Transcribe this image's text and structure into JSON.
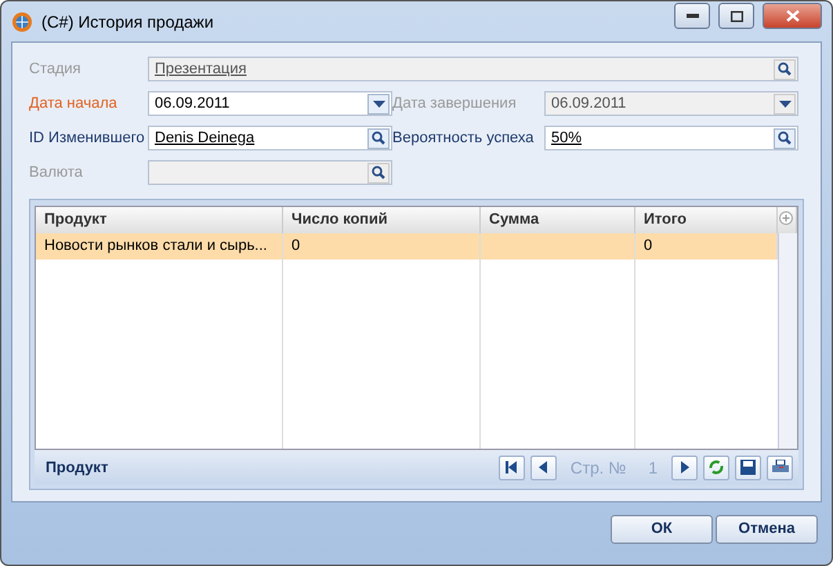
{
  "window": {
    "title": "(C#) История продажи"
  },
  "fields": [
    {
      "label": "Стадия",
      "value": "Презентация",
      "disabled": true,
      "required": false,
      "link": true,
      "kind": "search",
      "wide": true
    },
    {
      "label": "Дата начала",
      "value": "06.09.2011",
      "disabled": false,
      "required": true,
      "link": false,
      "kind": "dropdown",
      "wide": false
    },
    {
      "label": "Дата завершения",
      "value": "06.09.2011",
      "disabled": true,
      "required": false,
      "link": false,
      "kind": "dropdown",
      "wide": false
    },
    {
      "label": "ID Изменившего",
      "value": "Denis Deinega",
      "disabled": false,
      "required": false,
      "link": true,
      "kind": "search",
      "wide": false
    },
    {
      "label": "Вероятность успеха",
      "value": "50%",
      "disabled": false,
      "required": false,
      "link": true,
      "kind": "search",
      "wide": false
    },
    {
      "label": "Валюта",
      "disabled": true,
      "required": false,
      "link": false,
      "kind": "search",
      "wide": false
    }
  ],
  "table": {
    "columns": [
      "Продукт",
      "Число копий",
      "Сумма",
      "Итого"
    ],
    "rows": [
      {
        "selected": true,
        "cells": [
          "Новости рынков стали и сырь...",
          "0",
          "",
          "0"
        ]
      }
    ],
    "footer_label": "Продукт",
    "page_label": "Стр. №",
    "page": "1"
  },
  "buttons": [
    "ОК",
    "Отмена"
  ]
}
